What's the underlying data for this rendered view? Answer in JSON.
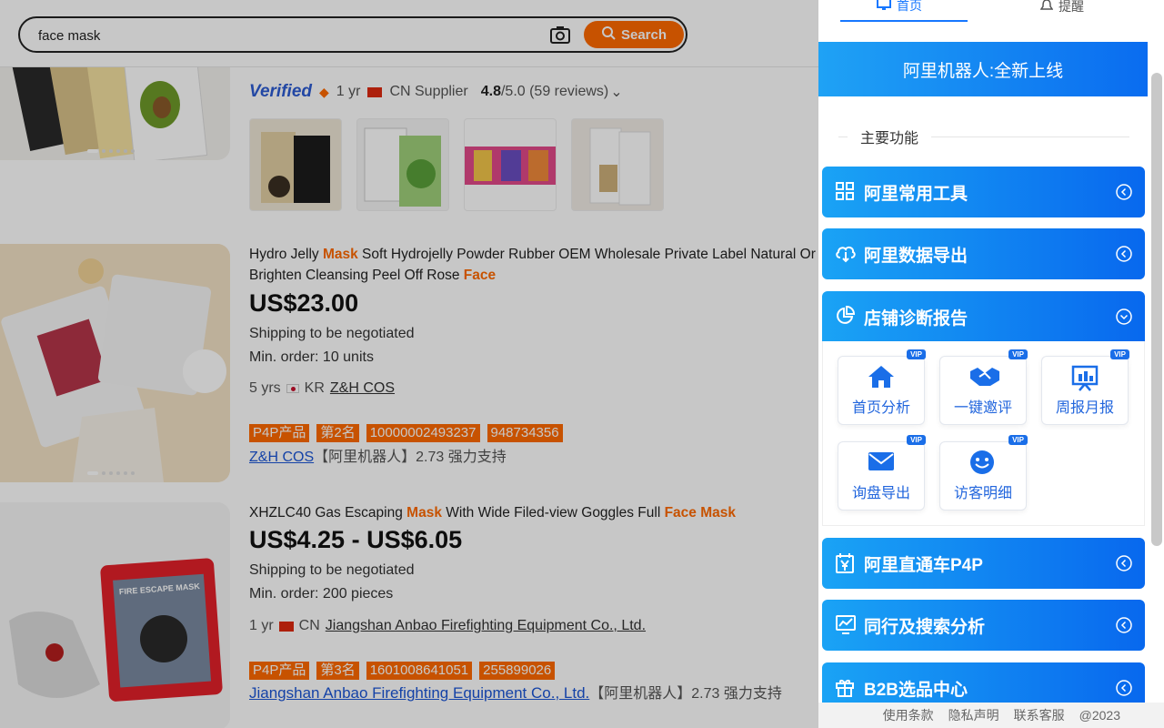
{
  "search": {
    "value": "face mask",
    "button_label": "Search"
  },
  "products": [
    {
      "verified": "Verified",
      "years": "1 yr",
      "country": "CN Supplier",
      "rating": "4.8",
      "rating_suffix": "/5.0 (59 reviews)"
    },
    {
      "title_pre": "Hydro Jelly ",
      "title_hl1": "Mask",
      "title_mid": " Soft Hydrojelly Powder Rubber OEM Wholesale Private Label Natural Or",
      "title_line2": "Brighten Cleansing Peel Off Rose ",
      "title_hl2": "Face",
      "price": "US$23.00",
      "shipping": "Shipping to be negotiated",
      "min_order": "Min. order: 10 units",
      "years": "5 yrs",
      "country": "KR",
      "supplier": "Z&H COS",
      "tags": [
        "P4P产品",
        "第2名",
        "10000002493237",
        "948734356"
      ],
      "support_link": "Z&H COS",
      "support_text": "【阿里机器人】2.73 强力支持"
    },
    {
      "title_pre": "XHZLC40 Gas Escaping ",
      "title_hl1": "Mask",
      "title_mid": " With Wide Filed-view Goggles Full ",
      "title_hl2": "Face Mask",
      "price": "US$4.25 - US$6.05",
      "shipping": "Shipping to be negotiated",
      "min_order": "Min. order: 200 pieces",
      "years": "1 yr",
      "country": "CN",
      "supplier": "Jiangshan Anbao Firefighting Equipment Co., Ltd.",
      "tags": [
        "P4P产品",
        "第3名",
        "1601008641051",
        "255899026"
      ],
      "support_link": "Jiangshan Anbao Firefighting Equipment Co., Ltd.",
      "support_text": "【阿里机器人】2.73 强力支持"
    }
  ],
  "panel": {
    "tabs": [
      "首页",
      "提醒"
    ],
    "banner": "阿里机器人:全新上线",
    "section_title": "主要功能",
    "accordions": [
      {
        "label": "阿里常用工具",
        "icon": "grid-icon"
      },
      {
        "label": "阿里数据导出",
        "icon": "cloud-download-icon"
      },
      {
        "label": "店铺诊断报告",
        "icon": "pie-chart-icon"
      },
      {
        "label": "阿里直通车P4P",
        "icon": "yen-calendar-icon"
      },
      {
        "label": "同行及搜索分析",
        "icon": "chart-monitor-icon"
      },
      {
        "label": "B2B选品中心",
        "icon": "gift-icon"
      }
    ],
    "cards": [
      {
        "label": "首页分析",
        "badge": "VIP",
        "icon": "home-icon"
      },
      {
        "label": "一键邀评",
        "badge": "VIP",
        "icon": "handshake-icon"
      },
      {
        "label": "周报月报",
        "badge": "VIP",
        "icon": "report-board-icon"
      },
      {
        "label": "询盘导出",
        "badge": "VIP",
        "icon": "mail-icon"
      },
      {
        "label": "访客明细",
        "badge": "VIP",
        "icon": "smile-icon"
      }
    ],
    "footer": [
      "使用条款",
      "隐私声明",
      "联系客服",
      "@2023"
    ]
  },
  "colors": {
    "accent": "#ff6a00",
    "panel_blue": "#0a6cf0"
  }
}
